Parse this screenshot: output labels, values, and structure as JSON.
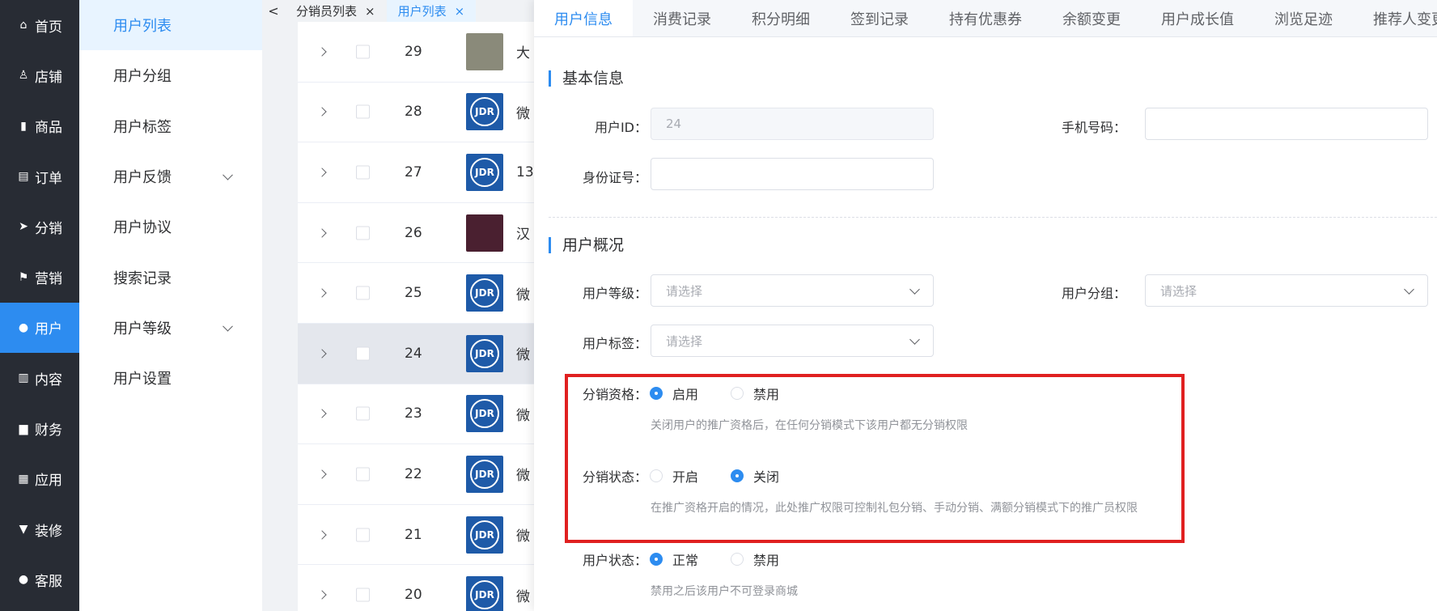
{
  "nav": {
    "items": [
      {
        "icon": "home-icon",
        "glyph": "⌂",
        "label": "首页"
      },
      {
        "icon": "store-icon",
        "glyph": "♙",
        "label": "店铺"
      },
      {
        "icon": "bag-icon",
        "glyph": "▮",
        "label": "商品"
      },
      {
        "icon": "clipboard-icon",
        "glyph": "▤",
        "label": "订单"
      },
      {
        "icon": "send-icon",
        "glyph": "➤",
        "label": "分销"
      },
      {
        "icon": "flag-icon",
        "glyph": "⚑",
        "label": "营销"
      },
      {
        "icon": "user-icon",
        "glyph": "●",
        "label": "用户"
      },
      {
        "icon": "book-icon",
        "glyph": "▥",
        "label": "内容"
      },
      {
        "icon": "bar-chart-icon",
        "glyph": "▆",
        "label": "财务"
      },
      {
        "icon": "grid-icon",
        "glyph": "▦",
        "label": "应用"
      },
      {
        "icon": "brush-icon",
        "glyph": "▼",
        "label": "装修"
      },
      {
        "icon": "headset-icon",
        "glyph": "●",
        "label": "客服"
      }
    ]
  },
  "submenu": {
    "items": [
      "用户列表",
      "用户分组",
      "用户标签",
      "用户反馈",
      "用户协议",
      "搜索记录",
      "用户等级",
      "用户设置"
    ]
  },
  "tabs": {
    "items": [
      {
        "label": "分销员列表",
        "close": "×"
      },
      {
        "label": "用户列表",
        "close": "×"
      }
    ],
    "back": "<"
  },
  "list": {
    "rows": [
      {
        "id": "29",
        "name": "大"
      },
      {
        "id": "28",
        "name": "微"
      },
      {
        "id": "27",
        "name": "13"
      },
      {
        "id": "26",
        "name": "汉"
      },
      {
        "id": "25",
        "name": "微"
      },
      {
        "id": "24",
        "name": "微"
      },
      {
        "id": "23",
        "name": "微"
      },
      {
        "id": "22",
        "name": "微"
      },
      {
        "id": "21",
        "name": "微"
      },
      {
        "id": "20",
        "name": "微"
      }
    ],
    "avatar_text": "JDR"
  },
  "drawer": {
    "tabs": [
      "用户信息",
      "消费记录",
      "积分明细",
      "签到记录",
      "持有优惠券",
      "余额变更",
      "用户成长值",
      "浏览足迹",
      "推荐人变更"
    ],
    "basic": {
      "title": "基本信息",
      "user_id_label": "用户ID：",
      "user_id_value": "24",
      "phone_label": "手机号码：",
      "idcard_label": "身份证号："
    },
    "overview": {
      "title": "用户概况",
      "level_label": "用户等级：",
      "group_label": "用户分组：",
      "tag_label": "用户标签：",
      "placeholder": "请选择"
    },
    "distribution": {
      "qual_label": "分销资格：",
      "qual_on": "启用",
      "qual_off": "禁用",
      "qual_hint": "关闭用户的推广资格后，在任何分销模式下该用户都无分销权限",
      "status_label": "分销状态：",
      "status_on": "开启",
      "status_off": "关闭",
      "status_hint": "在推广资格开启的情况，此处推广权限可控制礼包分销、手动分销、满额分销模式下的推广员权限"
    },
    "user_status": {
      "label": "用户状态：",
      "normal": "正常",
      "disabled": "禁用",
      "hint": "禁用之后该用户不可登录商城"
    }
  },
  "colors": {
    "accent": "#2d8cf0",
    "sidebar": "#282c34",
    "highlight_box": "#e02020"
  }
}
